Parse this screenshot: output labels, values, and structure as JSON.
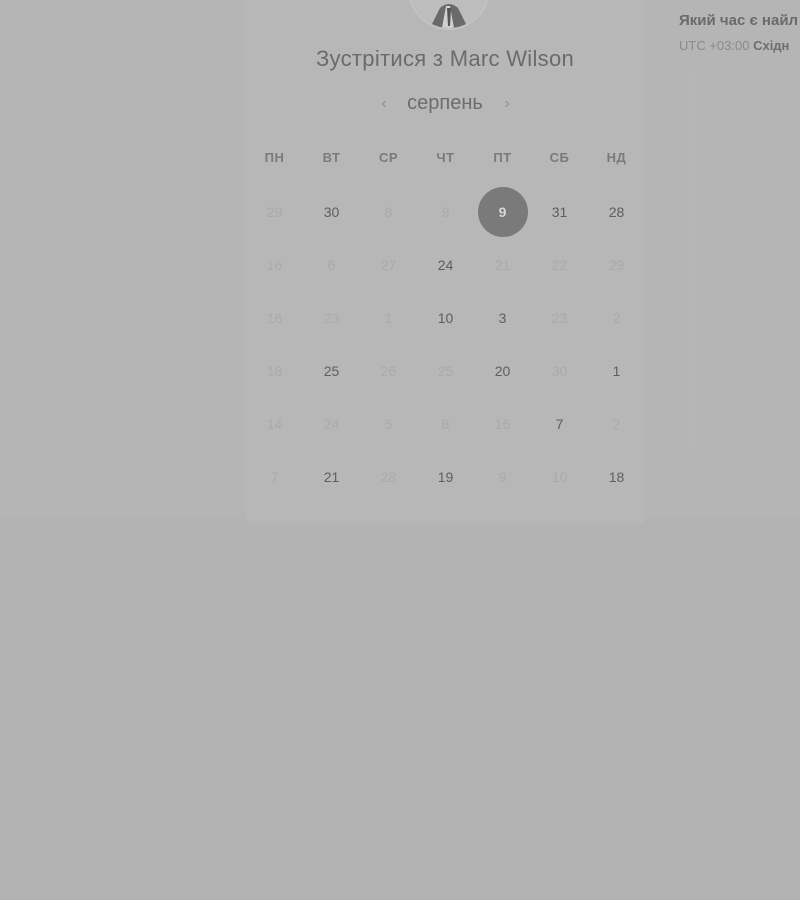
{
  "meeting": {
    "title": "Зустрітися з Marc Wilson"
  },
  "calendar": {
    "month": "серпень",
    "prev_icon": "chevron-left-icon",
    "next_icon": "chevron-right-icon",
    "weekdays": [
      "ПН",
      "ВТ",
      "СР",
      "ЧТ",
      "ПТ",
      "СБ",
      "НД"
    ],
    "weeks": [
      [
        {
          "label": "29",
          "available": false
        },
        {
          "label": "30",
          "available": true
        },
        {
          "label": "8",
          "available": false
        },
        {
          "label": "9",
          "available": false
        },
        {
          "label": "9",
          "available": true,
          "selected": true
        },
        {
          "label": "31",
          "available": true
        },
        {
          "label": "28",
          "available": true
        }
      ],
      [
        {
          "label": "16",
          "available": false
        },
        {
          "label": "6",
          "available": false
        },
        {
          "label": "27",
          "available": false
        },
        {
          "label": "24",
          "available": true
        },
        {
          "label": "21",
          "available": false
        },
        {
          "label": "22",
          "available": false
        },
        {
          "label": "29",
          "available": false
        }
      ],
      [
        {
          "label": "16",
          "available": false
        },
        {
          "label": "23",
          "available": false
        },
        {
          "label": "1",
          "available": false
        },
        {
          "label": "10",
          "available": true
        },
        {
          "label": "3",
          "available": true
        },
        {
          "label": "23",
          "available": false
        },
        {
          "label": "2",
          "available": false
        }
      ],
      [
        {
          "label": "18",
          "available": false
        },
        {
          "label": "25",
          "available": true
        },
        {
          "label": "26",
          "available": false
        },
        {
          "label": "25",
          "available": false
        },
        {
          "label": "20",
          "available": true
        },
        {
          "label": "30",
          "available": false
        },
        {
          "label": "1",
          "available": true
        }
      ],
      [
        {
          "label": "14",
          "available": false
        },
        {
          "label": "24",
          "available": false
        },
        {
          "label": "5",
          "available": false
        },
        {
          "label": "8",
          "available": false
        },
        {
          "label": "16",
          "available": false
        },
        {
          "label": "7",
          "available": true
        },
        {
          "label": "2",
          "available": false
        }
      ],
      [
        {
          "label": "7",
          "available": false
        },
        {
          "label": "21",
          "available": true
        },
        {
          "label": "28",
          "available": false
        },
        {
          "label": "19",
          "available": true
        },
        {
          "label": "9",
          "available": false
        },
        {
          "label": "10",
          "available": false
        },
        {
          "label": "18",
          "available": true
        }
      ]
    ]
  },
  "times": {
    "question": "Який час є найл",
    "timezone_offset": "UTC +03:00",
    "timezone_name": "Східн"
  },
  "colors": {
    "overlay": "#b3b3b3",
    "selected_day": "#7a7a7a"
  }
}
